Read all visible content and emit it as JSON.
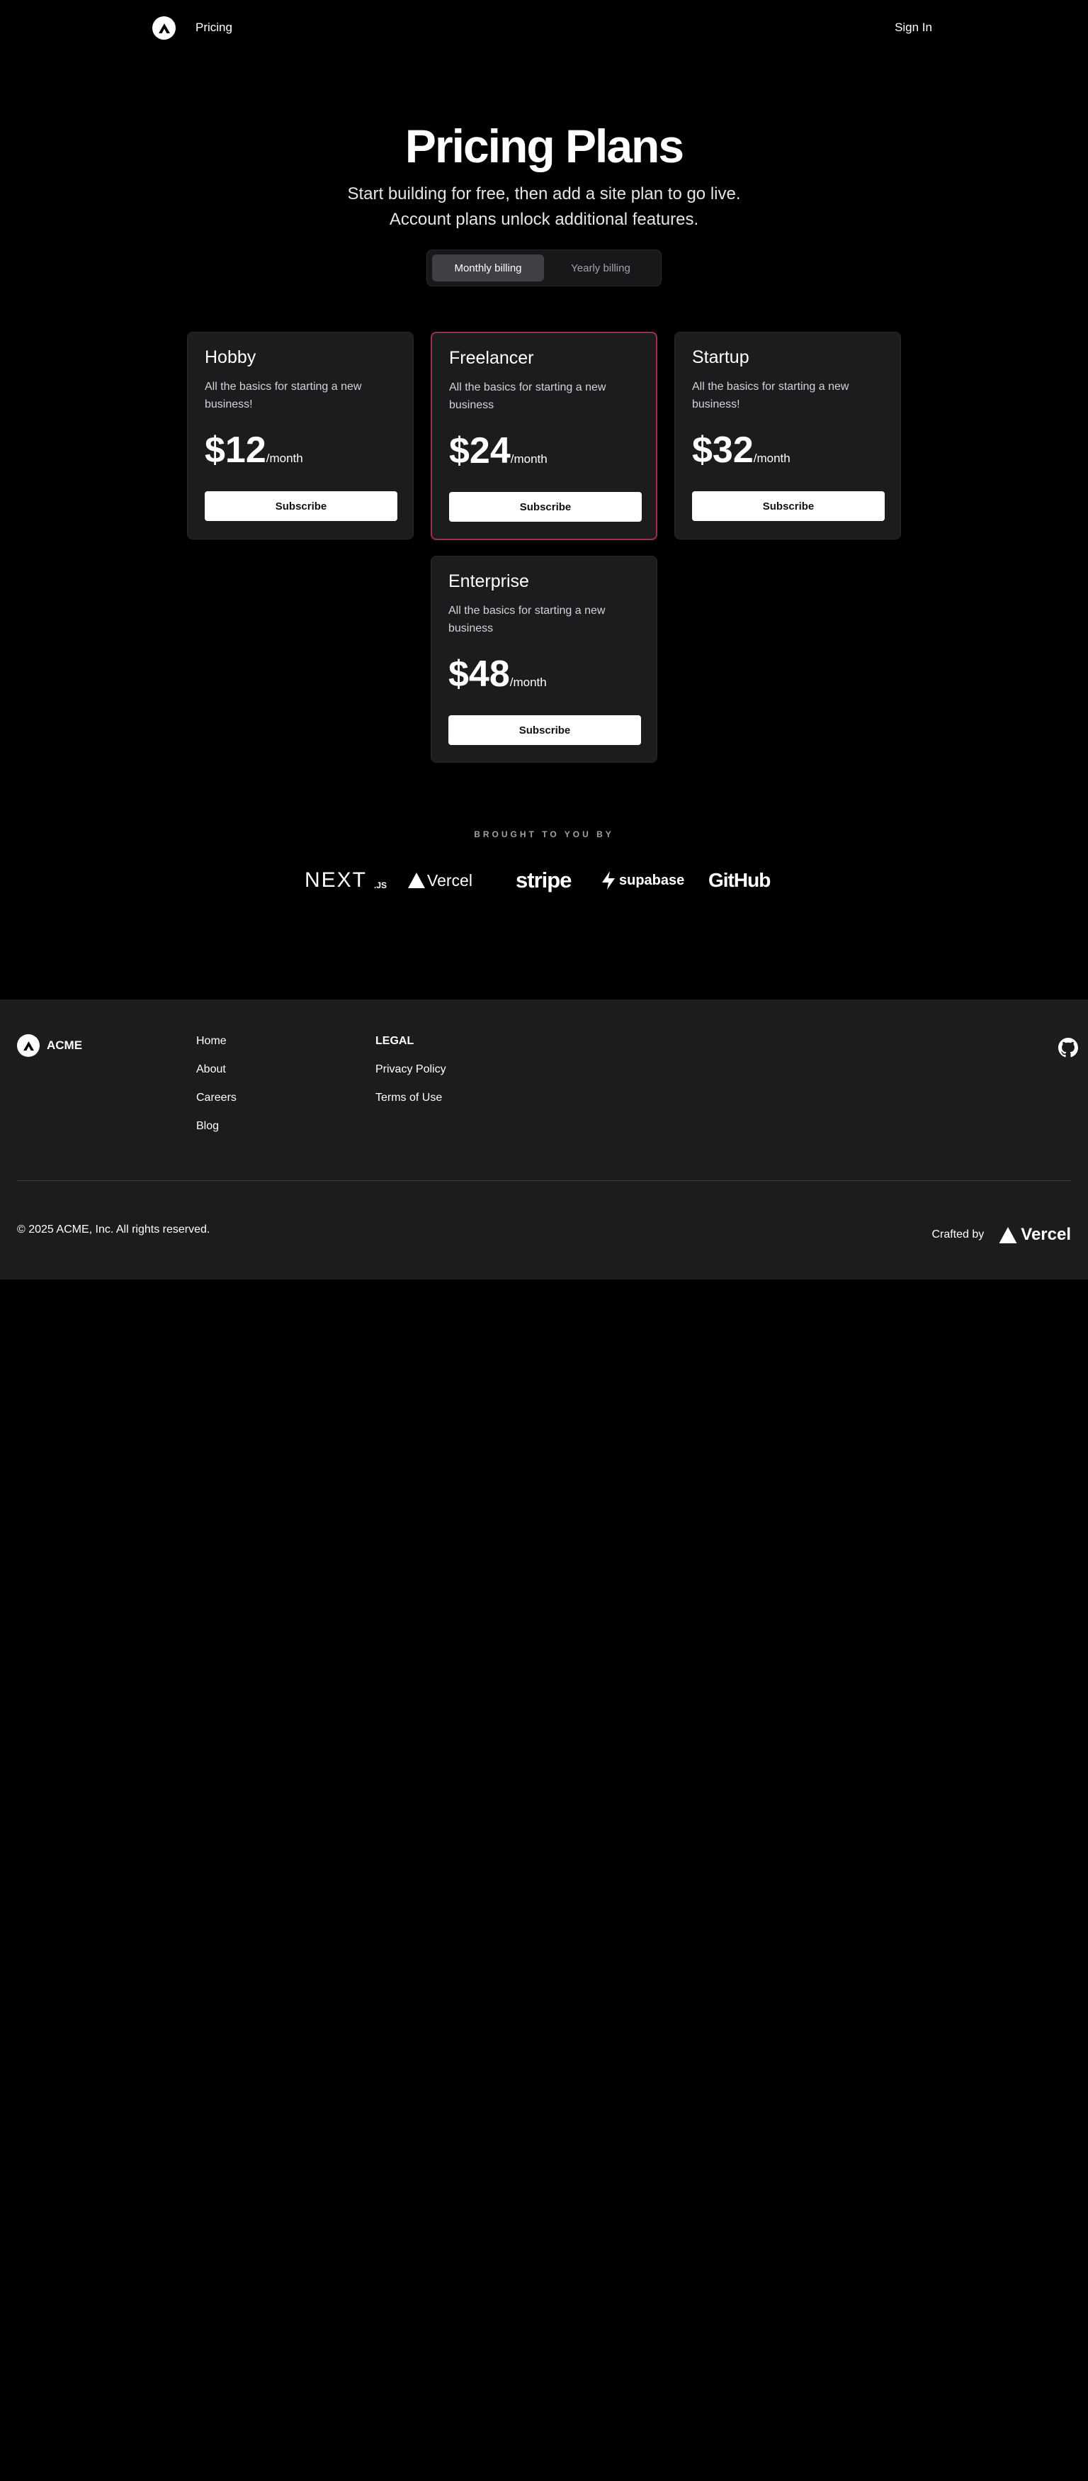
{
  "nav": {
    "logo_icon": "acme-logo-icon",
    "pricing_label": "Pricing",
    "signin_label": "Sign In"
  },
  "hero": {
    "title": "Pricing Plans",
    "subtitle": "Start building for free, then add a site plan to go live. Account plans unlock additional features."
  },
  "billing_toggle": {
    "monthly_label": "Monthly billing",
    "yearly_label": "Yearly billing",
    "selected": "Monthly billing"
  },
  "plans": [
    {
      "name": "Hobby",
      "description": "All the basics for starting a new business!",
      "price": "$12",
      "period": "/month",
      "button": "Subscribe",
      "highlighted": false
    },
    {
      "name": "Freelancer",
      "description": "All the basics for starting a new business",
      "price": "$24",
      "period": "/month",
      "button": "Subscribe",
      "highlighted": true
    },
    {
      "name": "Startup",
      "description": "All the basics for starting a new business!",
      "price": "$32",
      "period": "/month",
      "button": "Subscribe",
      "highlighted": false
    },
    {
      "name": "Enterprise",
      "description": "All the basics for starting a new business",
      "price": "$48",
      "period": "/month",
      "button": "Subscribe",
      "highlighted": false
    }
  ],
  "sponsors": {
    "heading": "BROUGHT TO YOU BY",
    "logos": [
      "NEXT.JS",
      "Vercel",
      "stripe",
      "supabase",
      "GitHub"
    ]
  },
  "footer": {
    "brand_name": "ACME",
    "links": [
      "Home",
      "About",
      "Careers",
      "Blog"
    ],
    "legal_heading": "LEGAL",
    "legal_links": [
      "Privacy Policy",
      "Terms of Use"
    ],
    "copyright": "© 2025 ACME, Inc. All rights reserved.",
    "crafted_by": "Crafted by",
    "crafted_logo": "Vercel",
    "github_icon": "github-icon"
  },
  "colors": {
    "background": "#000000",
    "card": "#1c1c1f",
    "highlight_border": "#9d2f4f",
    "footer": "#1c1c1f"
  }
}
